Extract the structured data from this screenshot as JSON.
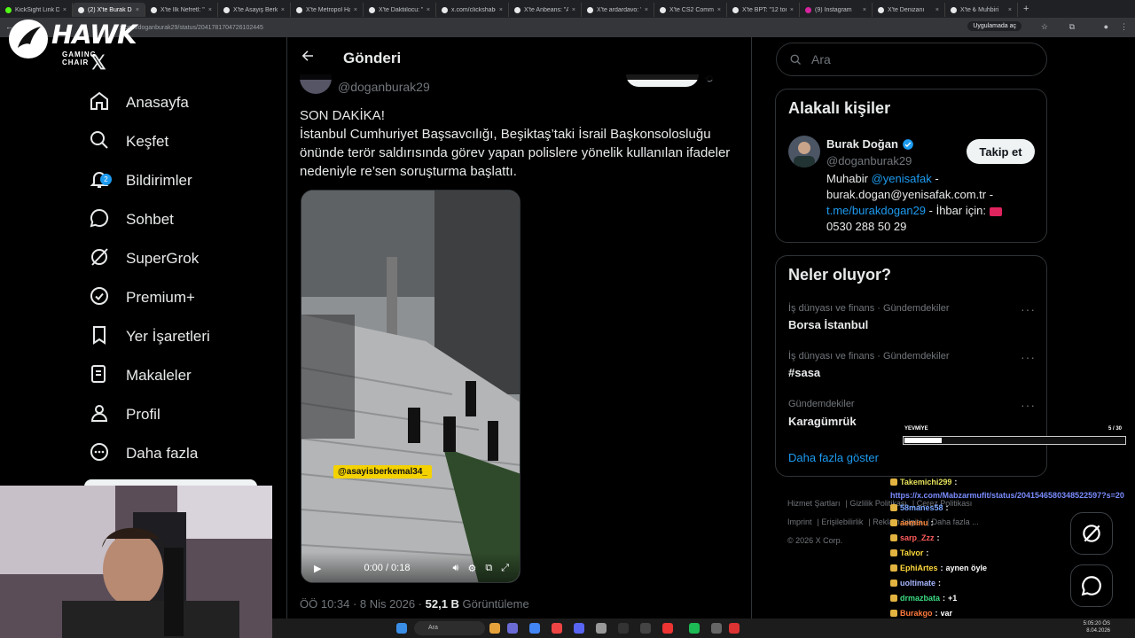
{
  "browser": {
    "tabs": [
      {
        "title": "KickSight Link De",
        "icon": "kick-favicon"
      },
      {
        "title": "(2) X'te Burak Do",
        "icon": "x-favicon",
        "active": true
      },
      {
        "title": "X'te İlk Nefretl: \"",
        "icon": "x-favicon"
      },
      {
        "title": "X'te Asayiş Berke",
        "icon": "x-favicon"
      },
      {
        "title": "X'te Metropol Ha",
        "icon": "x-favicon"
      },
      {
        "title": "X'te Daktiilocu: \"",
        "icon": "x-favicon"
      },
      {
        "title": "x.com/clickshabe",
        "icon": "x-favicon"
      },
      {
        "title": "X'te Anbeans: \"Ar",
        "icon": "x-favicon"
      },
      {
        "title": "X'te ardardavo: \"",
        "icon": "x-favicon"
      },
      {
        "title": "X'te CS2 Commu",
        "icon": "x-favicon"
      },
      {
        "title": "X'te BPT: \"12 ton",
        "icon": "x-favicon"
      },
      {
        "title": "(9) Instagram",
        "icon": "instagram-favicon"
      },
      {
        "title": "X'te Denizanı",
        "icon": "x-favicon"
      },
      {
        "title": "X'te ₺ Muhbiri",
        "icon": "x-favicon"
      }
    ],
    "url": "x.com/doganburak29/status/2041781704726102445",
    "app_button": "Uygulamada aç"
  },
  "overlay_logo": {
    "word": "HAWK",
    "sub": "GAMING CHAIR"
  },
  "nav": {
    "items": [
      {
        "label": "Anasayfa",
        "icon": "home-icon"
      },
      {
        "label": "Keşfet",
        "icon": "search-icon"
      },
      {
        "label": "Bildirimler",
        "icon": "bell-icon",
        "badge": "2"
      },
      {
        "label": "Sohbet",
        "icon": "chat-bubble-icon"
      },
      {
        "label": "SuperGrok",
        "icon": "grok-icon"
      },
      {
        "label": "Premium+",
        "icon": "verified-icon"
      },
      {
        "label": "Yer İşaretleri",
        "icon": "bookmark-icon"
      },
      {
        "label": "Makaleler",
        "icon": "article-icon"
      },
      {
        "label": "Profil",
        "icon": "person-icon"
      },
      {
        "label": "Daha fazla",
        "icon": "more-circle-icon"
      }
    ]
  },
  "post": {
    "header_title": "Gönderi",
    "author_handle": "@doganburak29",
    "text_lines": [
      "SON DAKİKA!",
      "İstanbul Cumhuriyet Başsavcılığı, Beşiktaş’taki İsrail Başkonsolosluğu",
      "önünde terör saldırısında görev yapan polislere yönelik kullanılan ifadeler",
      "nedeniyle re’sen soruşturma başlattı."
    ],
    "video": {
      "watermark": "@asayisberkemal34_",
      "time": "0:00 / 0:18"
    },
    "time": "ÖÖ 10:34 · 8 Nis 2026 · ",
    "views_value": "52,1 B",
    "views_label": " Görüntüleme"
  },
  "search": {
    "placeholder": "Ara"
  },
  "related": {
    "title": "Alakalı kişiler",
    "name": "Burak Doğan",
    "handle": "@doganburak29",
    "follow_label": "Takip et",
    "bio_1": "Muhabir ",
    "bio_link_1": "@yenisafak",
    "bio_2": " - burak.dogan@yenisafak.com.tr - ",
    "bio_link_2": "t.me/burakdogan29",
    "bio_3": " - İhbar için: ",
    "bio_phone": "0530 288 50 29"
  },
  "trends": {
    "title": "Neler oluyor?",
    "items": [
      {
        "category": "İş dünyası ve finans · Gündemdekiler",
        "name": "Borsa İstanbul"
      },
      {
        "category": "İş dünyası ve finans · Gündemdekiler",
        "name": "#sasa"
      },
      {
        "category": "Gündemdekiler",
        "name": "Karagümrük"
      }
    ],
    "show_more": "Daha fazla göster"
  },
  "footer": {
    "links": [
      "Hizmet Şartları",
      "Gizlilik Politikası",
      "Çerez Politikası",
      "Imprint",
      "Erişilebilirlik",
      "Reklam bilgisi",
      "Daha fazla ..."
    ],
    "copyright": "© 2026 X Corp."
  },
  "stream": {
    "daily_label": "YEVMİYE",
    "daily_count": "5 / 30",
    "daily_progress": 0.167,
    "chat": [
      {
        "user": "Takemichi299",
        "color": "#e6e15a",
        "msg": ""
      },
      {
        "user": "",
        "color": "#ffffff",
        "msg": "https://x.com/Mabzarmufit/status/2041546580348522597?s=20",
        "link": true
      },
      {
        "user": "58manes58",
        "color": "#7aa6ff",
        "msg": ""
      },
      {
        "user": "aeminu",
        "color": "#ff8a3d",
        "msg": ""
      },
      {
        "user": "sarp_Zzz",
        "color": "#ff5c5c",
        "msg": ""
      },
      {
        "user": "Talvor",
        "color": "#ffd93d",
        "msg": ""
      },
      {
        "user": "EphiArtes",
        "color": "#ffd93d",
        "msg": "aynen öyle"
      },
      {
        "user": "uoltimate",
        "color": "#a6b7ff",
        "msg": ""
      },
      {
        "user": "drmazbata",
        "color": "#3ddc84",
        "msg": "+1"
      },
      {
        "user": "Burakgo",
        "color": "#ff7a3d",
        "msg": "var"
      }
    ]
  },
  "taskbar": {
    "search": "Ara",
    "time": "5:05:20 ÖS",
    "date": "8.04.2026"
  },
  "colors": {
    "accent": "#1d9bf0",
    "bg": "#000000",
    "border": "#2f3336",
    "muted": "#71767b"
  }
}
